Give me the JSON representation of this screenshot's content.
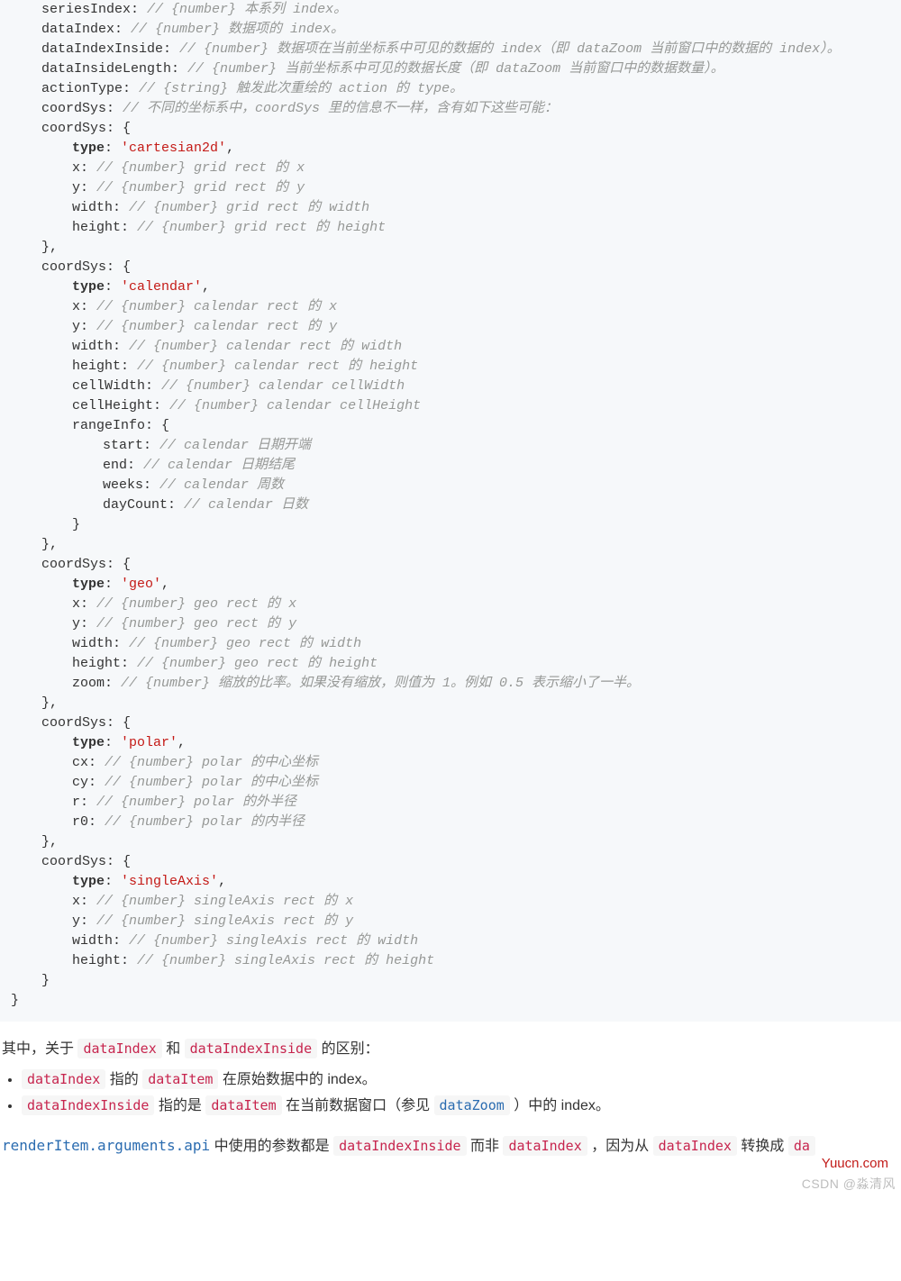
{
  "code": {
    "lines": [
      {
        "ind": 1,
        "key": "seriesIndex",
        "c": "// {number} 本系列 index。"
      },
      {
        "ind": 1,
        "key": "dataIndex",
        "c": "// {number} 数据项的 index。"
      },
      {
        "ind": 1,
        "key": "dataIndexInside",
        "c": "// {number} 数据项在当前坐标系中可见的数据的 index（即 dataZoom 当前窗口中的数据的 index）。"
      },
      {
        "ind": 1,
        "key": "dataInsideLength",
        "c": "// {number} 当前坐标系中可见的数据长度（即 dataZoom 当前窗口中的数据数量）。"
      },
      {
        "ind": 1,
        "key": "actionType",
        "c": "// {string} 触发此次重绘的 action 的 type。"
      },
      {
        "ind": 1,
        "key": "coordSys",
        "c": "// 不同的坐标系中，coordSys 里的信息不一样，含有如下这些可能："
      },
      {
        "ind": 1,
        "open": true,
        "key": "coordSys"
      },
      {
        "ind": 2,
        "bold": true,
        "key": "type",
        "str": "'cartesian2d'"
      },
      {
        "ind": 2,
        "key": "x",
        "c": "// {number} grid rect 的 x"
      },
      {
        "ind": 2,
        "key": "y",
        "c": "// {number} grid rect 的 y"
      },
      {
        "ind": 2,
        "key": "width",
        "c": "// {number} grid rect 的 width"
      },
      {
        "ind": 2,
        "key": "height",
        "c": "// {number} grid rect 的 height"
      },
      {
        "ind": 1,
        "close": "},"
      },
      {
        "ind": 1,
        "open": true,
        "key": "coordSys"
      },
      {
        "ind": 2,
        "bold": true,
        "key": "type",
        "str": "'calendar'"
      },
      {
        "ind": 2,
        "key": "x",
        "c": "// {number} calendar rect 的 x"
      },
      {
        "ind": 2,
        "key": "y",
        "c": "// {number} calendar rect 的 y"
      },
      {
        "ind": 2,
        "key": "width",
        "c": "// {number} calendar rect 的 width"
      },
      {
        "ind": 2,
        "key": "height",
        "c": "// {number} calendar rect 的 height"
      },
      {
        "ind": 2,
        "key": "cellWidth",
        "c": "// {number} calendar cellWidth"
      },
      {
        "ind": 2,
        "key": "cellHeight",
        "c": "// {number} calendar cellHeight"
      },
      {
        "ind": 2,
        "open": true,
        "key": "rangeInfo"
      },
      {
        "ind": 3,
        "key": "start",
        "c": "// calendar 日期开端"
      },
      {
        "ind": 3,
        "key": "end",
        "c": "// calendar 日期结尾"
      },
      {
        "ind": 3,
        "key": "weeks",
        "c": "// calendar 周数"
      },
      {
        "ind": 3,
        "key": "dayCount",
        "c": "// calendar 日数"
      },
      {
        "ind": 2,
        "close": "}"
      },
      {
        "ind": 1,
        "close": "},"
      },
      {
        "ind": 1,
        "open": true,
        "key": "coordSys"
      },
      {
        "ind": 2,
        "bold": true,
        "key": "type",
        "str": "'geo'"
      },
      {
        "ind": 2,
        "key": "x",
        "c": "// {number} geo rect 的 x"
      },
      {
        "ind": 2,
        "key": "y",
        "c": "// {number} geo rect 的 y"
      },
      {
        "ind": 2,
        "key": "width",
        "c": "// {number} geo rect 的 width"
      },
      {
        "ind": 2,
        "key": "height",
        "c": "// {number} geo rect 的 height"
      },
      {
        "ind": 2,
        "key": "zoom",
        "c": "// {number} 缩放的比率。如果没有缩放，则值为 1。例如 0.5 表示缩小了一半。"
      },
      {
        "ind": 1,
        "close": "},"
      },
      {
        "ind": 1,
        "open": true,
        "key": "coordSys"
      },
      {
        "ind": 2,
        "bold": true,
        "key": "type",
        "str": "'polar'"
      },
      {
        "ind": 2,
        "key": "cx",
        "c": "// {number} polar 的中心坐标"
      },
      {
        "ind": 2,
        "key": "cy",
        "c": "// {number} polar 的中心坐标"
      },
      {
        "ind": 2,
        "key": "r",
        "c": "// {number} polar 的外半径"
      },
      {
        "ind": 2,
        "key": "r0",
        "c": "// {number} polar 的内半径"
      },
      {
        "ind": 1,
        "close": "},"
      },
      {
        "ind": 1,
        "open": true,
        "key": "coordSys"
      },
      {
        "ind": 2,
        "bold": true,
        "key": "type",
        "str": "'singleAxis'"
      },
      {
        "ind": 2,
        "key": "x",
        "c": "// {number} singleAxis rect 的 x"
      },
      {
        "ind": 2,
        "key": "y",
        "c": "// {number} singleAxis rect 的 y"
      },
      {
        "ind": 2,
        "key": "width",
        "c": "// {number} singleAxis rect 的 width"
      },
      {
        "ind": 2,
        "key": "height",
        "c": "// {number} singleAxis rect 的 height"
      },
      {
        "ind": 1,
        "close": "}"
      },
      {
        "ind": 0,
        "close": "}"
      }
    ]
  },
  "p1": {
    "t1": "其中，关于 ",
    "c1": "dataIndex",
    "t2": " 和 ",
    "c2": "dataIndexInside",
    "t3": " 的区别："
  },
  "li1": {
    "c1": "dataIndex",
    "t1": " 指的 ",
    "c2": "dataItem",
    "t2": " 在原始数据中的 index。"
  },
  "li2": {
    "c1": "dataIndexInside",
    "t1": " 指的是 ",
    "c2": "dataItem",
    "t2": " 在当前数据窗口（参见 ",
    "link": "dataZoom",
    "t3": "）中的 index。"
  },
  "p2": {
    "link1": "renderItem.arguments.api",
    "t1": " 中使用的参数都是 ",
    "c1": "dataIndexInside",
    "t2": " 而非 ",
    "c2": "dataIndex",
    "t3": "，因为从 ",
    "c3": "dataIndex",
    "t4": " 转换成 ",
    "c4": "da"
  },
  "brand": "Yuucn.com",
  "wm": "CSDN @淼清风"
}
